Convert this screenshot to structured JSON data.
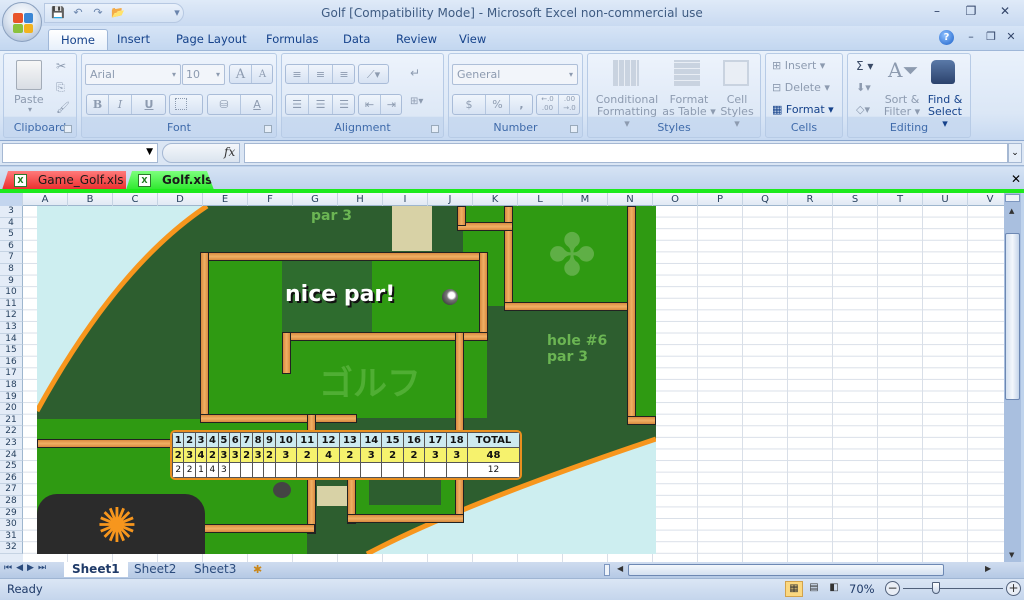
{
  "window": {
    "title": "Golf  [Compatibility Mode] - Microsoft Excel non-commercial use",
    "controls": {
      "minimize": "–",
      "restore": "❐",
      "close": "✕"
    }
  },
  "quick_access": {
    "save_icon": "💾",
    "undo_icon": "↶",
    "redo_icon": "↷",
    "open_icon": "📂",
    "customize_icon": "▾"
  },
  "ribbon": {
    "tabs": [
      "Home",
      "Insert",
      "Page Layout",
      "Formulas",
      "Data",
      "Review",
      "View"
    ],
    "active_tab": "Home",
    "help_icon": "?",
    "groups": {
      "clipboard": {
        "label": "Clipboard",
        "paste": "Paste"
      },
      "font": {
        "label": "Font",
        "font_name": "Arial",
        "font_size": "10",
        "grow": "A",
        "shrink": "A",
        "bold": "B",
        "italic": "I",
        "underline": "U"
      },
      "alignment": {
        "label": "Alignment"
      },
      "number": {
        "label": "Number",
        "format": "General",
        "currency": "$",
        "percent": "%",
        "comma": ",",
        "inc_decimal": "←.0 .00",
        "dec_decimal": ".00 →.0"
      },
      "styles": {
        "label": "Styles",
        "conditional_formatting": [
          "Conditional",
          "Formatting ▾"
        ],
        "format_as_table": [
          "Format",
          "as Table ▾"
        ],
        "cell_styles": [
          "Cell",
          "Styles ▾"
        ]
      },
      "cells": {
        "label": "Cells",
        "insert": "Insert ▾",
        "delete": "Delete ▾",
        "format": "Format ▾"
      },
      "editing": {
        "label": "Editing",
        "autosum": "Σ ▾",
        "sort_filter": [
          "Sort &",
          "Filter ▾"
        ],
        "find_select": [
          "Find &",
          "Select ▾"
        ]
      }
    }
  },
  "formula_bar": {
    "name_box": "",
    "fx_label": "fx",
    "formula": ""
  },
  "workbooks": [
    {
      "name": "Game_Golf.xls",
      "color": "#f03a3a",
      "active": false
    },
    {
      "name": "Golf.xls",
      "color": "#33e833",
      "active": true
    }
  ],
  "close_workbook": "✕",
  "grid": {
    "columns": [
      "A",
      "B",
      "C",
      "D",
      "E",
      "F",
      "G",
      "H",
      "I",
      "J",
      "K",
      "L",
      "M",
      "N",
      "O",
      "P",
      "Q",
      "R",
      "S",
      "T",
      "U",
      "V"
    ],
    "rows": [
      "3",
      "4",
      "5",
      "6",
      "7",
      "8",
      "9",
      "10",
      "11",
      "12",
      "13",
      "14",
      "15",
      "16",
      "17",
      "18",
      "19",
      "20",
      "21",
      "22",
      "23",
      "24",
      "25",
      "26",
      "27",
      "28",
      "29",
      "30",
      "31",
      "32"
    ]
  },
  "game": {
    "message": "nice par!",
    "current_hole_label": "hole #6",
    "current_par_label": "par 3",
    "prev_par_label": "par 3",
    "watermark": "ゴルフ",
    "colors": {
      "fairway": "#2f9a12",
      "rough": "#2d5e2f",
      "water": "#cdeef0",
      "wall": "#e9a457",
      "border": "#f7961d"
    },
    "scorecard": {
      "holes": [
        "1",
        "2",
        "3",
        "4",
        "5",
        "6",
        "7",
        "8",
        "9",
        "10",
        "11",
        "12",
        "13",
        "14",
        "15",
        "16",
        "17",
        "18"
      ],
      "total_label": "TOTAL",
      "par": [
        "2",
        "3",
        "4",
        "2",
        "3",
        "3",
        "2",
        "3",
        "2",
        "3",
        "2",
        "4",
        "2",
        "3",
        "2",
        "2",
        "3",
        "3"
      ],
      "par_total": "48",
      "strokes": [
        "2",
        "2",
        "1",
        "4",
        "3",
        "",
        "",
        "",
        "",
        "",
        "",
        "",
        "",
        "",
        "",
        "",
        "",
        ""
      ],
      "strokes_total": "12"
    }
  },
  "sheets": [
    "Sheet1",
    "Sheet2",
    "Sheet3"
  ],
  "active_sheet": "Sheet1",
  "status": {
    "text": "Ready",
    "zoom": "70%",
    "zoom_level_percent": 70
  }
}
